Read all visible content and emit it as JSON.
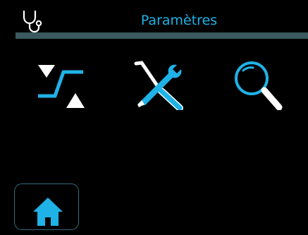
{
  "header": {
    "title": "Paramètres",
    "icon": "stethoscope-icon"
  },
  "menu": {
    "items": [
      {
        "name": "transitions",
        "icon": "triangles-transition-icon"
      },
      {
        "name": "tools",
        "icon": "wrench-screwdriver-icon"
      },
      {
        "name": "search",
        "icon": "magnifier-icon"
      }
    ]
  },
  "nav": {
    "home_icon": "home-icon"
  },
  "colors": {
    "accent": "#1fb2e6",
    "background": "#000000",
    "divider": "#3a5a5e",
    "home_border": "#2f6c7a"
  }
}
